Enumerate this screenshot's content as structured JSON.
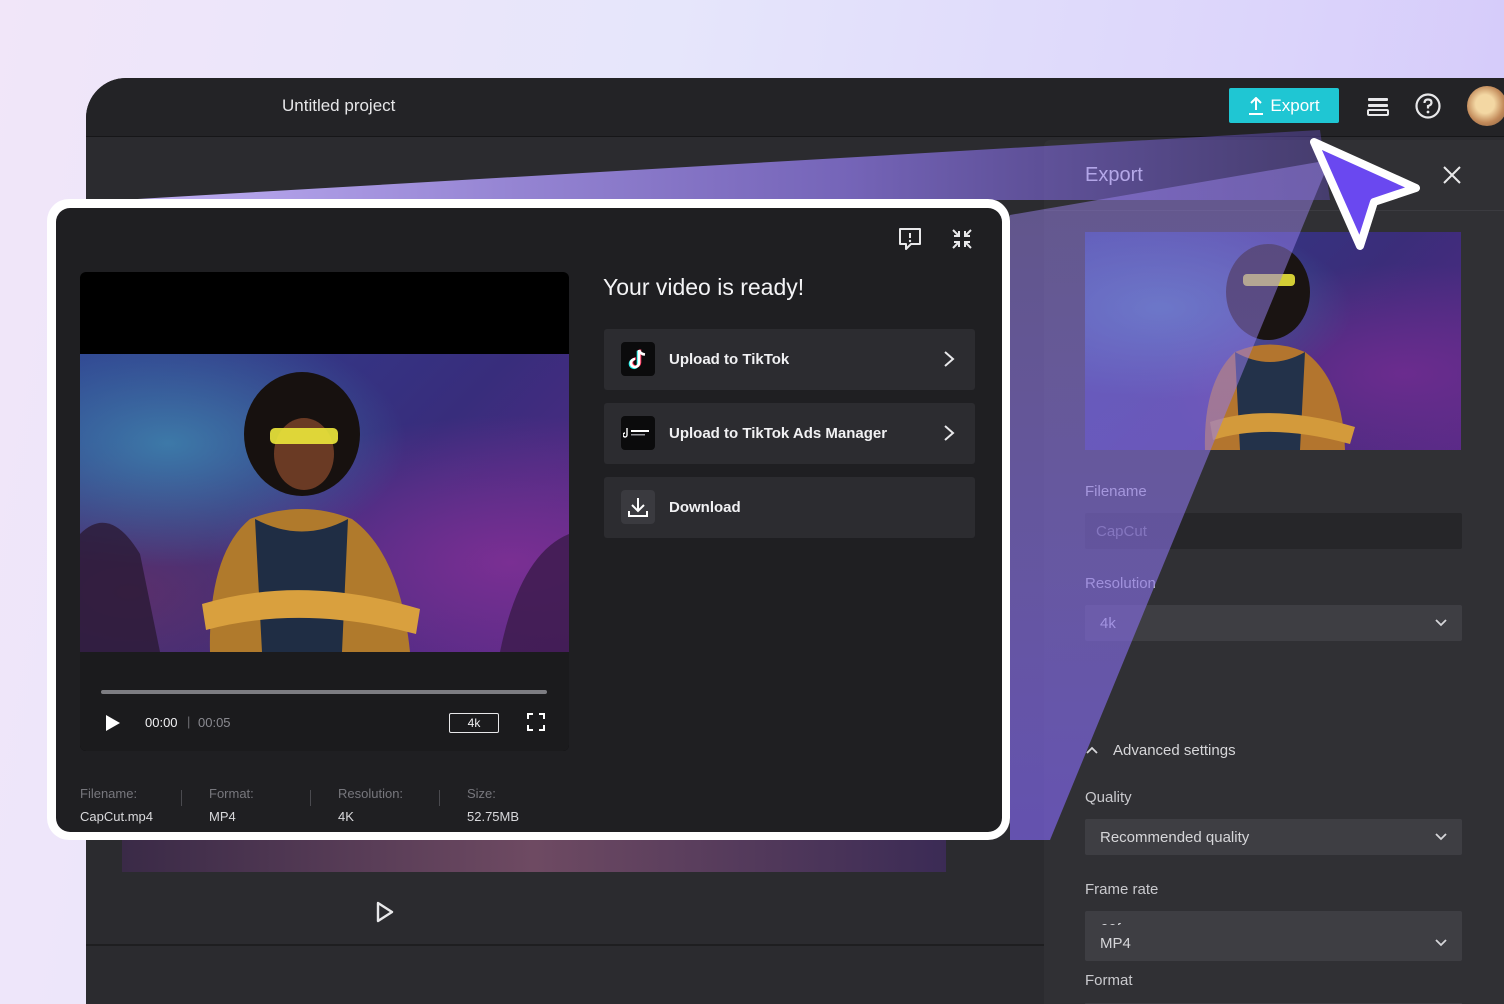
{
  "app": {
    "project_title": "Untitled project",
    "export_button": "Export",
    "top_icons": [
      "layers-icon",
      "help-icon",
      "avatar"
    ]
  },
  "side_panel": {
    "title": "Export",
    "filename_label": "Filename",
    "filename_value": "CapCut",
    "resolution_label": "Resolution",
    "resolution_value": "4k",
    "advanced_label": "Advanced settings",
    "quality_label": "Quality",
    "quality_value": "Recommended quality",
    "frame_rate_label": "Frame rate",
    "frame_rate_value": "60fps",
    "format_label": "Format",
    "format_value": "MP4"
  },
  "modal": {
    "title": "Your video is ready!",
    "actions": [
      {
        "label": "Upload to TikTok",
        "icon": "tiktok-icon"
      },
      {
        "label": "Upload to TikTok Ads Manager",
        "icon": "tiktok-business-icon"
      },
      {
        "label": "Download",
        "icon": "download-icon"
      }
    ],
    "player": {
      "current_time": "00:00",
      "separator": "|",
      "total_time": "00:05",
      "resolution_badge": "4k",
      "progress": 0
    },
    "meta": {
      "filename_label": "Filename:",
      "filename_value": "CapCut.mp4",
      "format_label": "Format:",
      "format_value": "MP4",
      "resolution_label": "Resolution:",
      "resolution_value": "4K",
      "size_label": "Size:",
      "size_value": "52.75MB"
    }
  },
  "colors": {
    "accent": "#1fc6d3",
    "cursor": "#6a48f0",
    "modal_bg": "#1f1f22"
  }
}
